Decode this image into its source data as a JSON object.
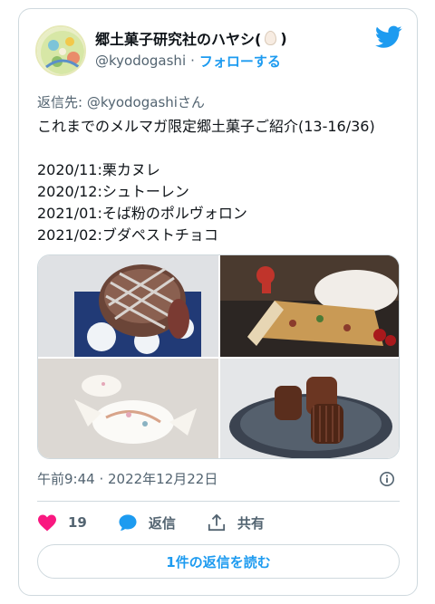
{
  "author": {
    "display_name_prefix": "郷土菓子研究社のハヤシ(",
    "display_name_suffix": ")",
    "handle": "@kyodogashi",
    "separator": "·",
    "follow_label": "フォローする"
  },
  "tweet": {
    "reply_to": "返信先: @kyodogashiさん",
    "text": "これまでのメルマガ限定郷土菓子ご紹介(13-16/36)\n\n2020/11:栗カヌレ\n2020/12:シュトーレン\n2021/01:そば粉のポルヴォロン\n2021/02:ブダペストチョコ",
    "timestamp": "午前9:44 · 2022年12月22日"
  },
  "actions": {
    "like_count": "19",
    "reply_label": "返信",
    "share_label": "共有"
  },
  "read_replies_label": "1件の返信を読む",
  "colors": {
    "accent": "#1d9bf0",
    "like": "#f91880",
    "muted": "#536471",
    "border": "#cfd9de"
  },
  "icons": [
    "twitter-bird-icon",
    "info-icon",
    "heart-icon",
    "reply-bubble-icon",
    "share-icon",
    "egg-emoji"
  ]
}
